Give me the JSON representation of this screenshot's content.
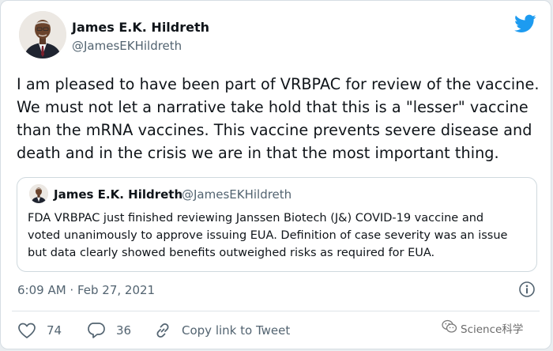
{
  "tweet": {
    "author_name": "James E.K. Hildreth",
    "author_handle": "@JamesEKHildreth",
    "text": "I am pleased to have been part of VRBPAC for review of the vaccine.\nWe must not let a narrative take hold that this is a \"lesser\" vaccine\nthan the mRNA vaccines. This vaccine prevents severe disease and\ndeath and in the crisis we are in that the most important thing.",
    "timestamp": "6:09 AM · Feb 27, 2021"
  },
  "quoted_tweet": {
    "author_name": "James E.K. Hildreth",
    "author_handle": "@JamesEKHildreth",
    "text": "FDA VRBPAC just finished reviewing Janssen Biotech (J&) COVID-19 vaccine and\nvoted unanimously to approve issuing EUA.  Definition of case severity was an issue\nbut data clearly showed benefits outweighed risks as required for EUA."
  },
  "actions": {
    "likes": "74",
    "replies": "36",
    "copy_link": "Copy link to Tweet"
  },
  "icons": {
    "brand": "twitter-bird-icon",
    "like": "heart-icon",
    "reply": "speech-bubble-icon",
    "link": "link-icon",
    "info": "info-icon"
  },
  "colors": {
    "twitter_blue": "#1d9bf0",
    "muted": "#536471"
  },
  "watermark": {
    "text": "Science科学"
  }
}
